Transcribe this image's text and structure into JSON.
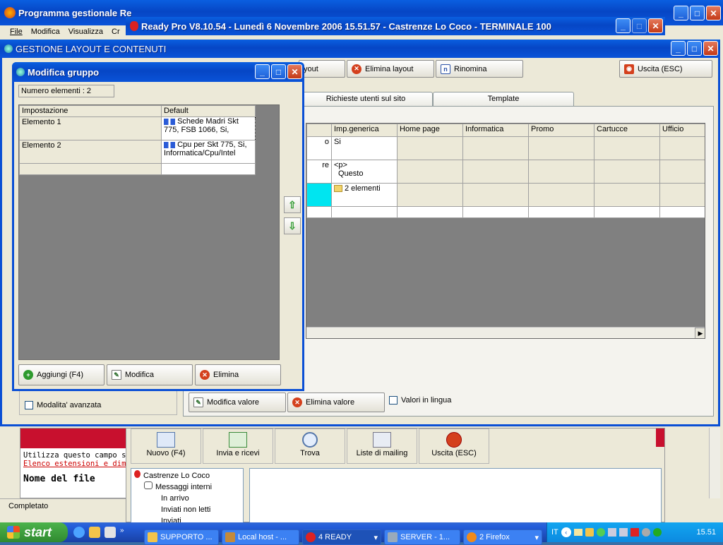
{
  "firefox": {
    "title": "Programma gestionale Re",
    "menu": [
      "File",
      "Modifica",
      "Visualizza",
      "Cr"
    ]
  },
  "ready": {
    "title": "Ready Pro V8.10.54 - Lunedì 6 Novembre 2006  15.51.57 - Castrenze Lo Coco - TERMINALE 100"
  },
  "gestione": {
    "title": "GESTIONE LAYOUT E CONTENUTI",
    "toolbar": {
      "layout_btn": "yout",
      "elimina_layout": "Elimina layout",
      "rinomina": "Rinomina",
      "uscita": "Uscita (ESC)"
    },
    "tabs": [
      "Richieste utenti sul sito",
      "Template"
    ],
    "grid": {
      "headers": [
        "Imp.generica",
        "Home page",
        "Informatica",
        "Promo",
        "Cartucce",
        "Ufficio"
      ],
      "partial_left": [
        "o",
        "re"
      ],
      "cells": [
        "Si",
        "<p>",
        "Questo",
        "2 elementi"
      ]
    },
    "modalita": "Modalita' avanzata",
    "modifica_valore": "Modifica valore",
    "elimina_valore": "Elimina valore",
    "valori_lingua": "Valori in lingua"
  },
  "dialog": {
    "title": "Modifica gruppo",
    "count": "Numero elementi : 2",
    "headers": [
      "Impostazione",
      "Default"
    ],
    "rows": [
      {
        "name": "Elemento 1",
        "line1": "Schede Madri Skt",
        "line2": "775, FSB 1066, Si,"
      },
      {
        "name": "Elemento 2",
        "line1": "Cpu per Skt 775, Si,",
        "line2": "Informatica/Cpu/Intel"
      }
    ],
    "aggiungi": "Aggiungi (F4)",
    "modifica": "Modifica",
    "elimina": "Elimina"
  },
  "mail": {
    "buttons": [
      "Nuovo (F4)",
      "Invia e ricevi",
      "Trova",
      "Liste di mailing",
      "Uscita (ESC)"
    ],
    "tree_root": "Castrenze Lo Coco",
    "tree": [
      "Messaggi interni",
      "In arrivo",
      "Inviati non letti",
      "Inviati"
    ]
  },
  "browser": {
    "hint": "Utilizza questo campo se",
    "link": "Elenco estensioni e dimen",
    "label": "Nome del file",
    "status": "Completato"
  },
  "taskbar": {
    "start": "start",
    "items": [
      "SUPPORTO ...",
      "Local host - ...",
      "4 READY",
      "SERVER - 1...",
      "2 Firefox"
    ],
    "lang": "IT",
    "clock": "15.51"
  }
}
